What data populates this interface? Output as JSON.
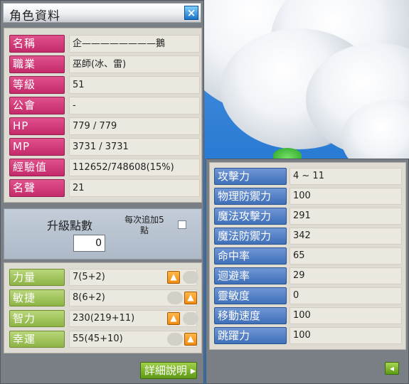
{
  "window": {
    "title": "角色資料"
  },
  "character": {
    "rows": [
      {
        "label": "名稱",
        "value": "企————————鵝"
      },
      {
        "label": "職業",
        "value": "巫師(冰、雷)"
      },
      {
        "label": "等級",
        "value": "51"
      },
      {
        "label": "公會",
        "value": "-"
      },
      {
        "label": "HP",
        "value": "779 / 779"
      },
      {
        "label": "MP",
        "value": "3731 / 3731"
      },
      {
        "label": "經驗值",
        "value": "112652/748608(15%)"
      },
      {
        "label": "名聲",
        "value": "21"
      }
    ]
  },
  "ability_points": {
    "label": "升級點數",
    "value": "0",
    "auto_label": "每次追加5\n點",
    "auto_checked": false
  },
  "stats": [
    {
      "label": "力量",
      "value": "7(5+2)"
    },
    {
      "label": "敏捷",
      "value": "8(6+2)"
    },
    {
      "label": "智力",
      "value": "230(219+11)"
    },
    {
      "label": "幸運",
      "value": "55(45+10)"
    }
  ],
  "detail_button": {
    "label": "詳細說明"
  },
  "details": {
    "rows": [
      {
        "label": "攻擊力",
        "value": "4 ~ 11"
      },
      {
        "label": "物理防禦力",
        "value": "100"
      },
      {
        "label": "魔法攻擊力",
        "value": "291"
      },
      {
        "label": "魔法防禦力",
        "value": "342"
      },
      {
        "label": "命中率",
        "value": "65"
      },
      {
        "label": "迴避率",
        "value": "29"
      },
      {
        "label": "靈敏度",
        "value": "0"
      },
      {
        "label": "移動速度",
        "value": "100"
      },
      {
        "label": "跳躍力",
        "value": "100"
      }
    ]
  },
  "icons": {
    "close": "close-icon",
    "up": "up-arrow-icon",
    "back": "back-arrow-icon"
  },
  "colors": {
    "label_pink": "#c42a6a",
    "label_green": "#8db445",
    "label_blue": "#3f6fb8",
    "accent_orange": "#f08a10"
  }
}
